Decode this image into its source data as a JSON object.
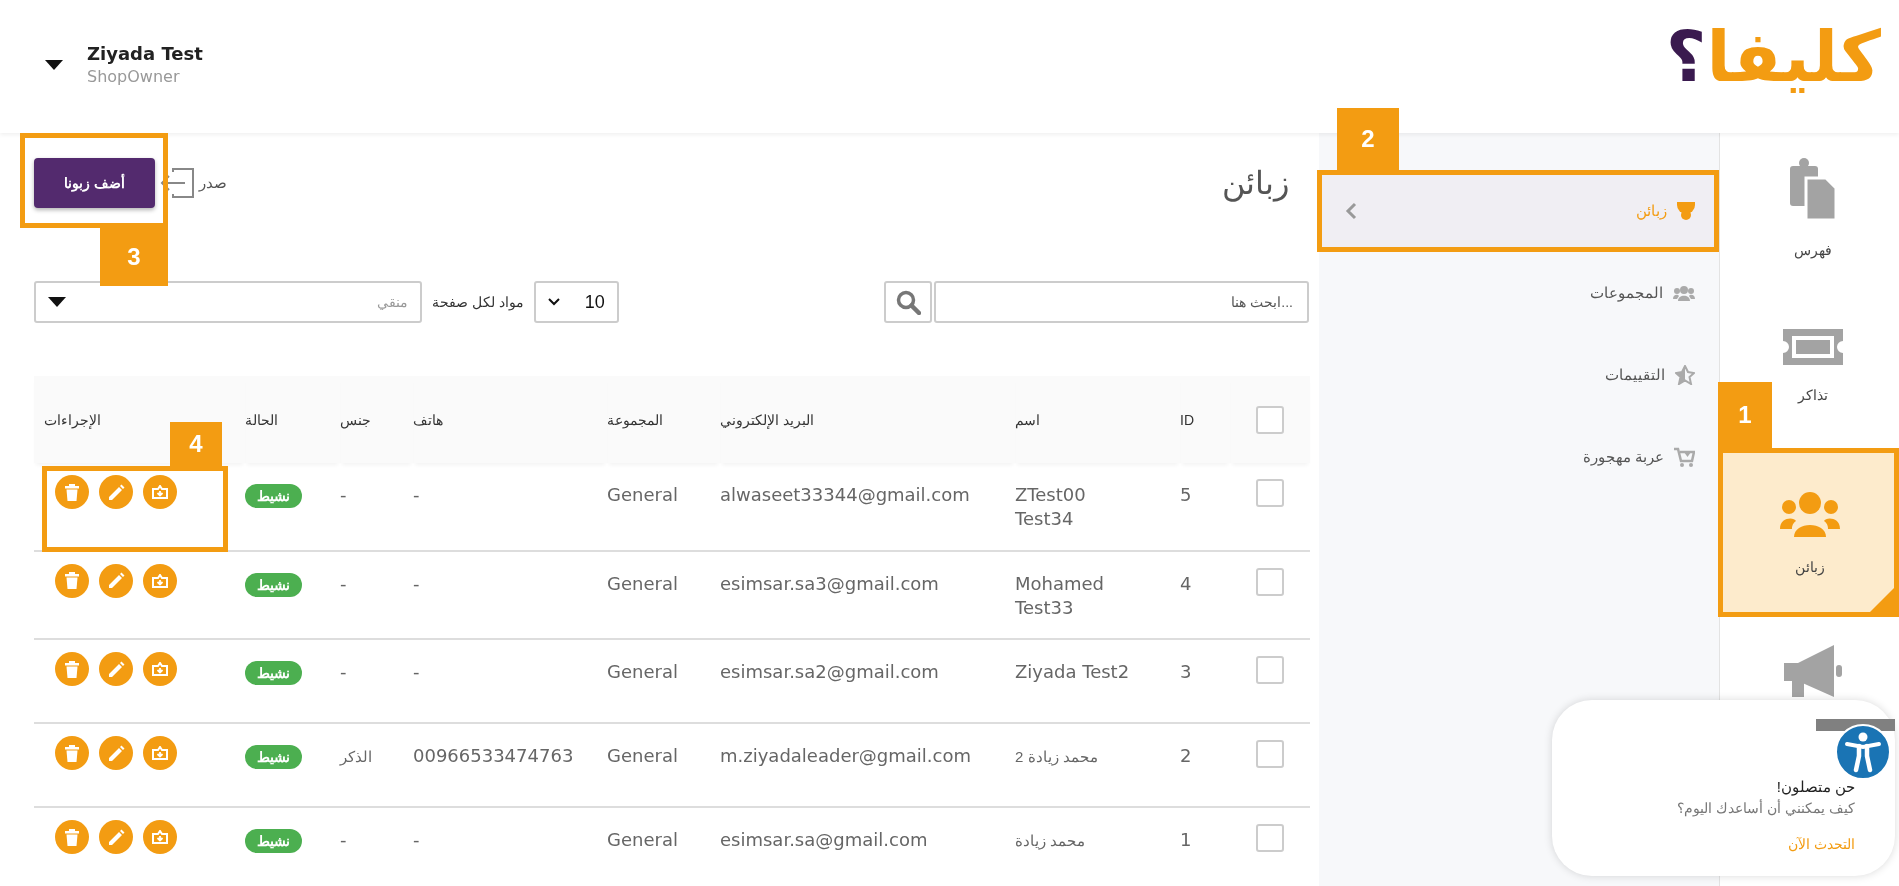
{
  "header": {
    "user": {
      "name": "Ziyada Test",
      "role": "ShopOwner"
    },
    "logo": {
      "text": "كليفا",
      "mark": "؟"
    }
  },
  "rail": [
    {
      "label": "فهرس",
      "selected": false
    },
    {
      "label": "تذاكر",
      "selected": false
    },
    {
      "label": "زبائن",
      "selected": true,
      "callout": "1"
    },
    {
      "selected": false
    }
  ],
  "subnav": [
    {
      "label": "زبائن",
      "selected": true,
      "callout": "2"
    },
    {
      "label": "المجموعات",
      "selected": false
    },
    {
      "label": "التقييمات",
      "selected": false
    },
    {
      "label": "عربة مهجورة",
      "selected": false
    }
  ],
  "page": {
    "title": "زبائن",
    "export_label": "صدر",
    "add_button": {
      "label": "أضف زبونا",
      "callout": "3"
    },
    "search": {
      "placeholder": "...ابحث هنا"
    },
    "per_page": {
      "value": "10",
      "label": "مواد لكل صفحة"
    },
    "filter": {
      "placeholder": "منقي"
    }
  },
  "table": {
    "header_checked": false,
    "columns": [
      "ID",
      "اسم",
      "البريد الإلكتروني",
      "المجموعة",
      "هاتف",
      "جنس",
      "الحالة",
      "الإجراءات"
    ],
    "rows": [
      {
        "checked": false,
        "id": "5",
        "name": "ZTest00 Test34",
        "email": "alwaseet33344@gmail.com",
        "group": "General",
        "phone": "-",
        "gender": "-",
        "status": {
          "label": "نشيط",
          "kind": "active"
        },
        "callout": "4"
      },
      {
        "checked": false,
        "id": "4",
        "name": "Mohamed Test33",
        "email": "esimsar.sa3@gmail.com",
        "group": "General",
        "phone": "-",
        "gender": "-",
        "status": {
          "label": "نشيط",
          "kind": "active"
        }
      },
      {
        "checked": false,
        "id": "3",
        "name": "Ziyada Test2",
        "email": "esimsar.sa2@gmail.com",
        "group": "General",
        "phone": "-",
        "gender": "-",
        "status": {
          "label": "نشيط",
          "kind": "active"
        }
      },
      {
        "checked": false,
        "id": "2",
        "name": "محمد زيادة 2",
        "email": "m.ziyadaleader@gmail.com",
        "group": "General",
        "phone": "00966533474763",
        "gender": "الذكر",
        "status": {
          "label": "نشيط",
          "kind": "active"
        }
      },
      {
        "checked": false,
        "id": "1",
        "name": "محمد زيادة",
        "email": "esimsar.sa@gmail.com",
        "group": "General",
        "phone": "-",
        "gender": "-",
        "status": {
          "label": "نشيط",
          "kind": "active"
        }
      }
    ]
  },
  "chat": {
    "title": "حن متصلون!",
    "message": "كيف يمكنني أن أساعدك اليوم؟",
    "link": "التحدث الآن"
  }
}
